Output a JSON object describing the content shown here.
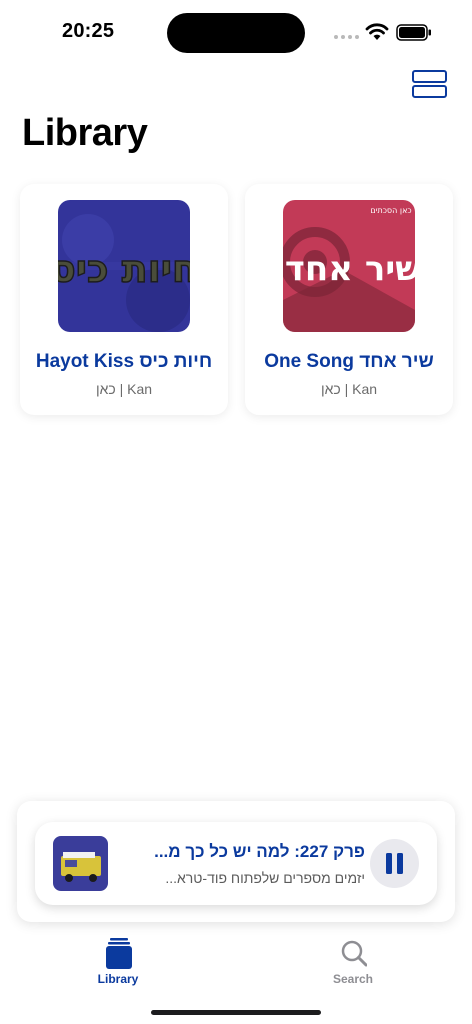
{
  "status_bar": {
    "time": "20:25"
  },
  "header": {
    "title": "Library",
    "layout_icon": "rows-layout-icon"
  },
  "podcasts": [
    {
      "title": "Hayot Kiss חיות כיס",
      "publisher": "כאן | Kan",
      "art_text": "חיות כיס",
      "art_color": "#33349a"
    },
    {
      "title": "One Song שיר אחד",
      "publisher": "כאן | Kan",
      "art_text": "שיר אחד",
      "art_badge": "כאן הסכתים",
      "art_color": "#c23a57"
    }
  ],
  "player": {
    "episode_title": "פרק 227: למה יש כל כך מ...",
    "episode_subtitle": "יזמים מספרים שלפתוח פוד-טרא...",
    "control": "pause-icon"
  },
  "tabs": [
    {
      "label": "Library",
      "icon": "library-icon",
      "active": true
    },
    {
      "label": "Search",
      "icon": "search-icon",
      "active": false
    }
  ],
  "colors": {
    "accent": "#0b3a9e",
    "inactive": "#8e8e93"
  }
}
